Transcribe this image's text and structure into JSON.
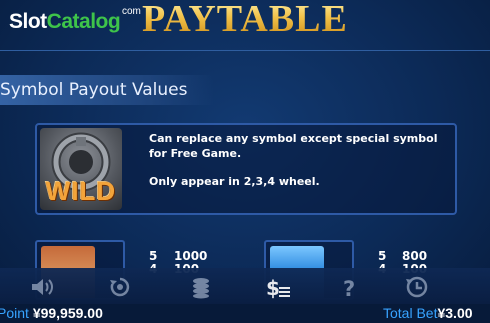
{
  "logo": {
    "part1": "Slot",
    "part2": "Catalog",
    "suffix": "com"
  },
  "title": "PAYTABLE",
  "section_title": "Symbol Payout Values",
  "wild": {
    "icon_label": "WILD",
    "line1": "Can replace any symbol except special symbol for Free Game.",
    "line2": "Only appear in 2,3,4 wheel."
  },
  "symbols": [
    {
      "icon": "hero-symbol",
      "rows": [
        {
          "count": "5",
          "pay": "1000"
        },
        {
          "count": "4",
          "pay": "100"
        }
      ]
    },
    {
      "icon": "gun-symbol",
      "rows": [
        {
          "count": "5",
          "pay": "800"
        },
        {
          "count": "4",
          "pay": "100"
        }
      ]
    }
  ],
  "toolbar": {
    "icons": [
      "speaker-icon",
      "autoplay-icon",
      "coins-icon",
      "paytable-icon",
      "help-icon",
      "history-icon"
    ]
  },
  "status": {
    "point_label": "Point",
    "point_value": "¥99,959.00",
    "bet_label": "Total Bet",
    "bet_value": "¥3.00"
  },
  "colors": {
    "accent": "#37a3ff",
    "title_gold": "#f2c24a",
    "panel_border": "#2e5aa6"
  }
}
